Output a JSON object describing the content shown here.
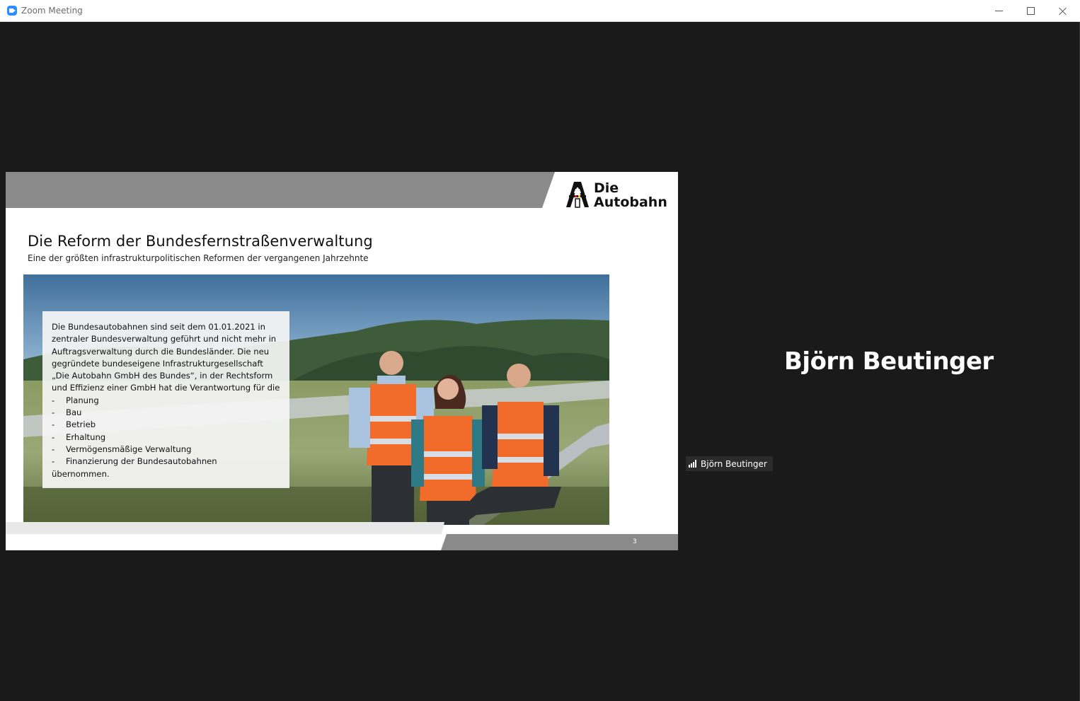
{
  "window": {
    "title": "Zoom Meeting"
  },
  "slide": {
    "title": "Die Reform der Bundesfernstraßenverwaltung",
    "subtitle": "Eine der größten infrastrukturpolitischen Reformen der vergangenen Jahrzehnte",
    "logo_line1": "Die",
    "logo_line2": "Autobahn",
    "intro_lines": [
      "Die Bundesautobahnen sind seit dem 01.01.2021 in",
      "zentraler Bundesverwaltung geführt und nicht mehr in",
      "Auftragsverwaltung durch die Bundesländer. Die neu",
      "gegründete bundeseigene Infrastrukturgesellschaft",
      "„Die Autobahn GmbH des Bundes“, in der Rechtsform",
      "und Effizienz einer GmbH hat die Verantwortung für die"
    ],
    "bullets": [
      "Planung",
      "Bau",
      "Betrieb",
      "Erhaltung",
      "Vermögensmäßige Verwaltung",
      "Finanzierung der Bundesautobahnen"
    ],
    "closing": "übernommen.",
    "page_number": "3"
  },
  "participant": {
    "display_name": "Björn Beutinger",
    "tag_name": "Björn Beutinger"
  },
  "colors": {
    "background": "#1a1a1a",
    "slide_bar_gray": "#8a8a8a",
    "text_white": "#ffffff"
  }
}
